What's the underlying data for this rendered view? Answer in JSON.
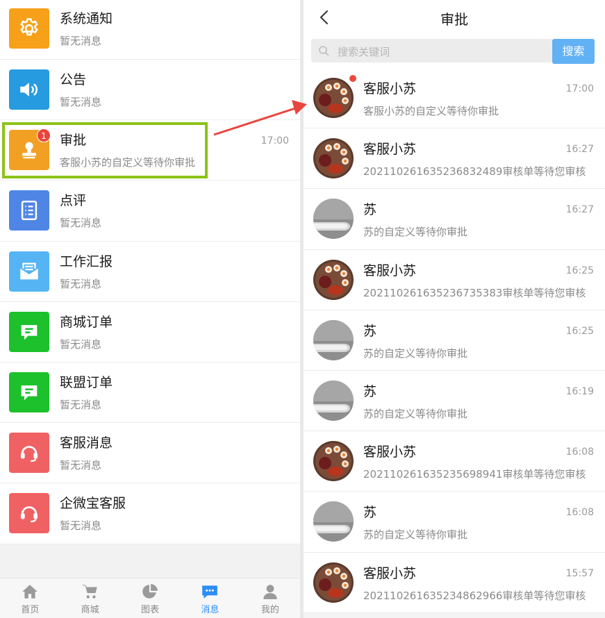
{
  "left": {
    "items": [
      {
        "title": "系统通知",
        "subtitle": "暂无消息",
        "time": "",
        "icon": "gear-icon",
        "color": "#f7a01a"
      },
      {
        "title": "公告",
        "subtitle": "暂无消息",
        "time": "",
        "icon": "speaker-icon",
        "color": "#279be0"
      },
      {
        "title": "审批",
        "subtitle": "客服小苏的自定义等待你审批",
        "time": "17:00",
        "icon": "stamp-icon",
        "color": "#f2a024",
        "badge": "1"
      },
      {
        "title": "点评",
        "subtitle": "暂无消息",
        "time": "",
        "icon": "document-icon",
        "color": "#4f86e6"
      },
      {
        "title": "工作汇报",
        "subtitle": "暂无消息",
        "time": "",
        "icon": "mail-icon",
        "color": "#55b4f4"
      },
      {
        "title": "商城订单",
        "subtitle": "暂无消息",
        "time": "",
        "icon": "chat-icon",
        "color": "#1cc12c"
      },
      {
        "title": "联盟订单",
        "subtitle": "暂无消息",
        "time": "",
        "icon": "chat-icon",
        "color": "#1cc12c"
      },
      {
        "title": "客服消息",
        "subtitle": "暂无消息",
        "time": "",
        "icon": "headset-icon",
        "color": "#f06163"
      },
      {
        "title": "企微宝客服",
        "subtitle": "暂无消息",
        "time": "",
        "icon": "headset-icon",
        "color": "#f06163"
      }
    ]
  },
  "tabbar": {
    "items": [
      {
        "label": "首页",
        "icon": "home-icon"
      },
      {
        "label": "商城",
        "icon": "cart-icon"
      },
      {
        "label": "图表",
        "icon": "pie-chart-icon"
      },
      {
        "label": "消息",
        "icon": "message-icon",
        "active": true
      },
      {
        "label": "我的",
        "icon": "user-icon"
      }
    ],
    "active_color": "#2c8df7"
  },
  "right": {
    "title": "审批",
    "search": {
      "placeholder": "搜索关键词",
      "button": "搜索"
    },
    "items": [
      {
        "name": "客服小苏",
        "message": "客服小苏的自定义等待你审批",
        "time": "17:00",
        "avatar": "tea-avatar",
        "unread": true
      },
      {
        "name": "客服小苏",
        "message": "20211026163523683248​9审核单等待您审核",
        "time": "16:27",
        "avatar": "tea-avatar"
      },
      {
        "name": "苏",
        "message": "苏的自定义等待你审批",
        "time": "16:27",
        "avatar": "handle-avatar"
      },
      {
        "name": "客服小苏",
        "message": "2021102616352367353​83审核单等待您审核",
        "time": "16:25",
        "avatar": "tea-avatar"
      },
      {
        "name": "苏",
        "message": "苏的自定义等待你审批",
        "time": "16:25",
        "avatar": "handle-avatar"
      },
      {
        "name": "苏",
        "message": "苏的自定义等待你审批",
        "time": "16:19",
        "avatar": "handle-avatar"
      },
      {
        "name": "客服小苏",
        "message": "2021102616352356989​41审核单等待您审核",
        "time": "16:08",
        "avatar": "tea-avatar"
      },
      {
        "name": "苏",
        "message": "苏的自定义等待你审批",
        "time": "16:08",
        "avatar": "handle-avatar"
      },
      {
        "name": "客服小苏",
        "message": "2021102616352348629​66审核单等待您审核",
        "time": "15:57",
        "avatar": "tea-avatar"
      }
    ]
  },
  "colors": {
    "highlight": "#8ec21a",
    "arrow": "#e8453c",
    "badge": "#e8453c"
  }
}
